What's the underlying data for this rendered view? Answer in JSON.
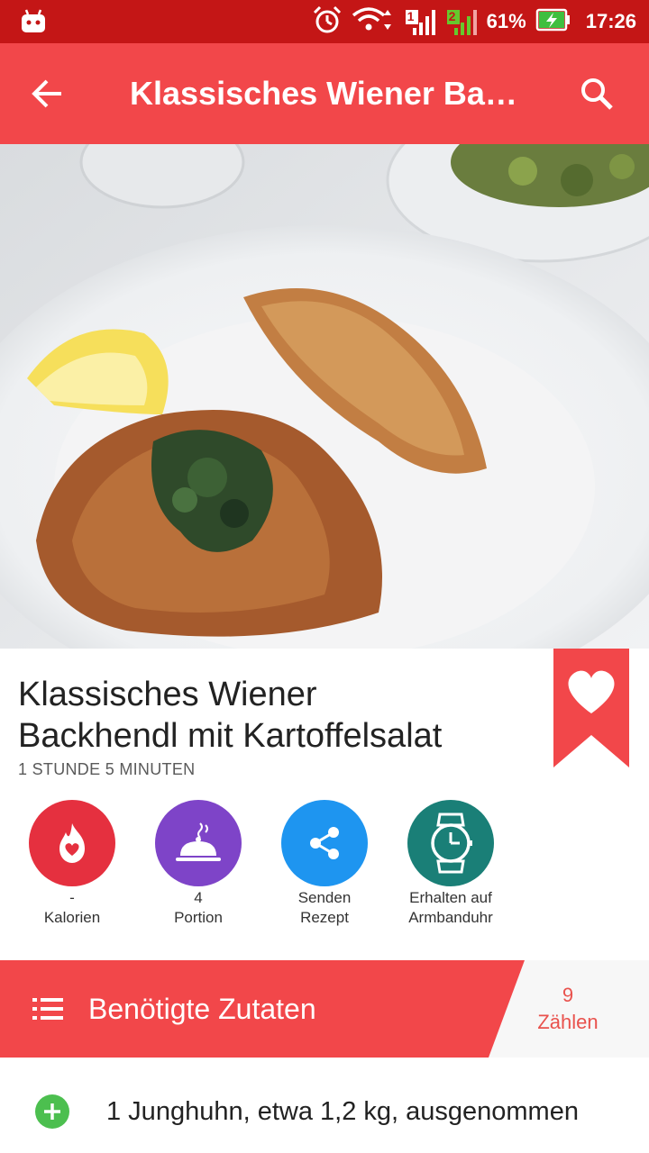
{
  "status_bar": {
    "battery_percent": "61%",
    "time": "17:26",
    "signal_slot_1": "1",
    "signal_slot_2": "2",
    "icons": [
      "android-icon",
      "alarm-icon",
      "wifi-icon",
      "signal-icon",
      "battery-charging-icon"
    ]
  },
  "app_bar": {
    "title": "Klassisches Wiener Backhendl mit Kartoffelsalat",
    "back_icon": "arrow-back-icon",
    "search_icon": "search-icon"
  },
  "recipe": {
    "title_line1": "Klassisches Wiener",
    "title_line2": "Backhendl mit Kartoffelsalat",
    "duration": "1 STUNDE 5 MINUTEN",
    "favorite_icon": "heart-icon"
  },
  "actions": [
    {
      "line1": "-",
      "line2": "Kalorien",
      "icon": "flame-heart-icon",
      "color": "#e5303f"
    },
    {
      "line1": "4",
      "line2": "Portion",
      "icon": "cloche-icon",
      "color": "#7e44c8"
    },
    {
      "line1": "Senden",
      "line2": "Rezept",
      "icon": "share-icon",
      "color": "#1e95f0"
    },
    {
      "line1": "Erhalten auf",
      "line2": "Armbanduhr",
      "icon": "watch-icon",
      "color": "#1a7f77"
    }
  ],
  "ingredients_header": {
    "label": "Benötigte Zutaten",
    "count": "9",
    "count_label": "Zählen"
  },
  "ingredients": [
    {
      "text": "1 Junghuhn, etwa 1,2 kg, ausgenommen"
    }
  ],
  "colors": {
    "status_bar": "#c41616",
    "app_bar": "#f2474a",
    "accent": "#f2474a",
    "plus_green": "#4cbf4f"
  }
}
